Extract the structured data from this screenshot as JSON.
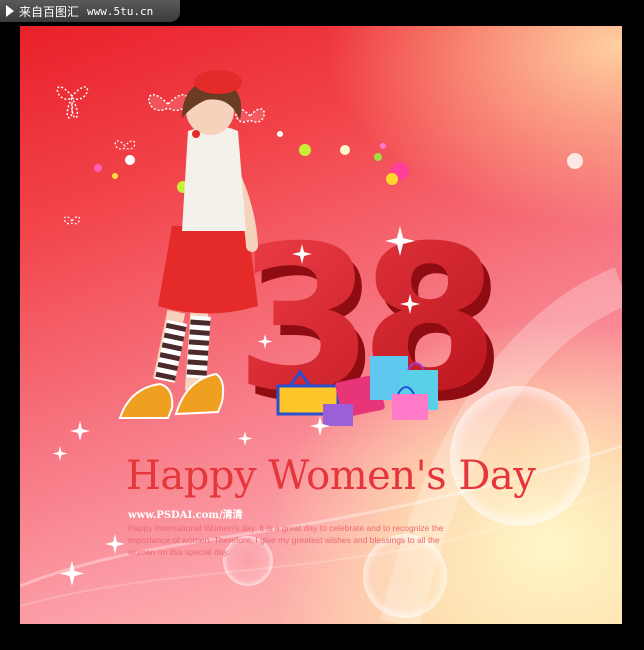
{
  "watermark": {
    "label": "来自百图汇",
    "site": "www.5tu.cn"
  },
  "poster": {
    "big_number": "38",
    "title": "Happy Women's Day",
    "credit": "www.PSDAI.com/清清",
    "body": "Happy International Women's day. It is a great day to celebrate and to recognize the importance of women. Therefore, I give my greatest wishes and blessings to all the women on this special day."
  },
  "colors": {
    "background_red": "#e9202a",
    "background_pink": "#f77a86",
    "glow_yellow": "#fff7c8",
    "number_red": "#d51d23",
    "title_red": "#e5363b"
  }
}
